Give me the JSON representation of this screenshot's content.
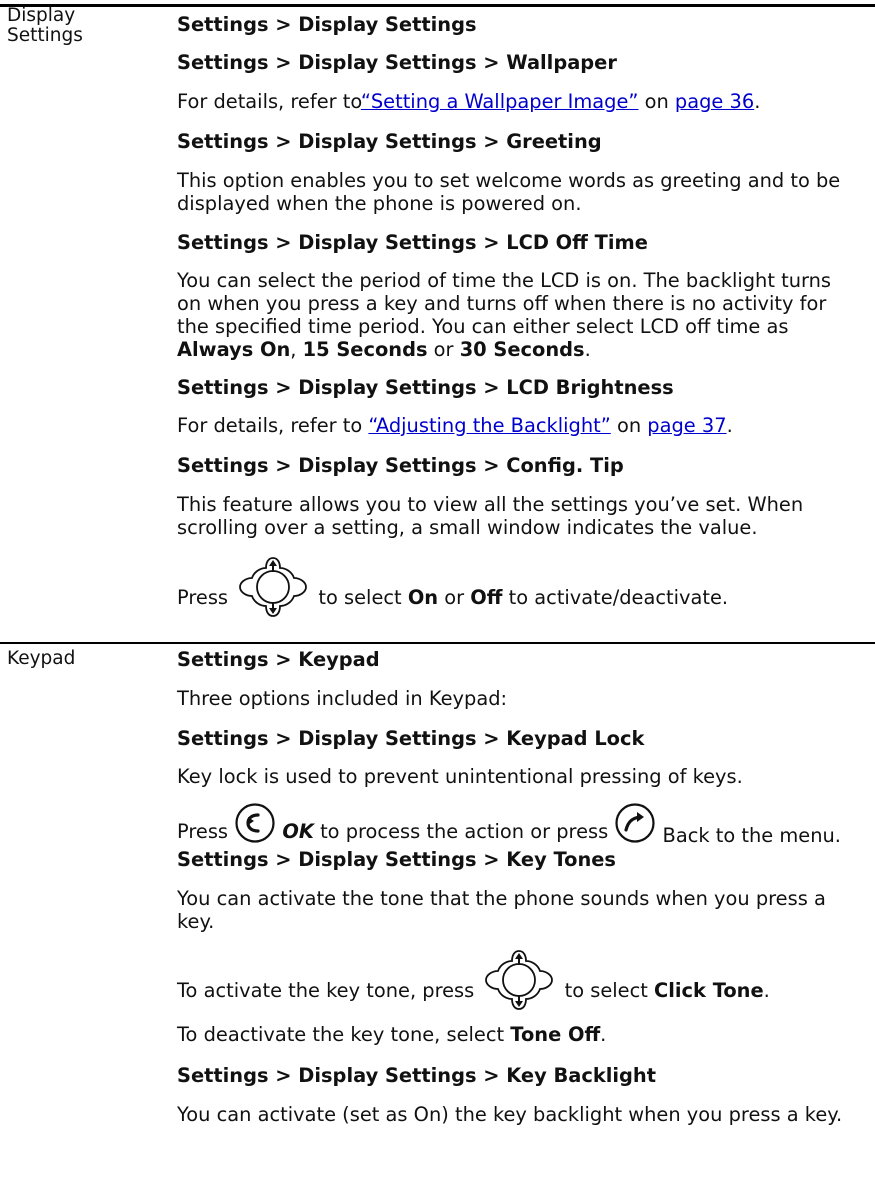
{
  "display_section": {
    "label_line1": "Display",
    "label_line2": "Settings",
    "h_main": "Settings > Display Settings",
    "h_wallpaper": "Settings > Display Settings > Wallpaper",
    "wallpaper_pre": "For details, refer to",
    "wallpaper_link": "“Setting a Wallpaper Image”",
    "wallpaper_on": " on ",
    "wallpaper_page": "page 36",
    "wallpaper_end": ".",
    "h_greeting": "Settings > Display Settings > Greeting",
    "greeting_l1": "This option enables you to set welcome words as greeting and to be",
    "greeting_l2": "displayed when the phone is powered on.",
    "h_lcd_off": "Settings > Display Settings > LCD Off Time",
    "lcd_l1": "You can select the period of time the LCD is on. The backlight turns",
    "lcd_l2": "on when you press a key and turns off when there is no activity for",
    "lcd_l3": "the specified time period. You can either select LCD off time as",
    "lcd_opt1": "Always On",
    "lcd_sep1": ", ",
    "lcd_opt2": "15 Seconds",
    "lcd_or": " or ",
    "lcd_opt3": "30 Seconds",
    "lcd_end": ".",
    "h_brightness": "Settings > Display Settings > LCD Brightness",
    "bright_pre": "For details, refer to ",
    "bright_link": "“Adjusting the Backlight”",
    "bright_on": " on ",
    "bright_page": "page 37",
    "bright_end": ".",
    "h_config": "Settings > Display Settings > Config. Tip",
    "config_l1": "This feature allows you to view all the settings you’ve set. When",
    "config_l2": "scrolling over a setting, a small window indicates the value.",
    "press": "Press",
    "press_mid": " to select ",
    "press_on": "On",
    "press_or": " or ",
    "press_off": "Off",
    "press_end": " to activate/deactivate."
  },
  "keypad_section": {
    "label": "Keypad",
    "h_main": "Settings > Keypad",
    "intro": "Three options included in Keypad:",
    "h_lock": "Settings > Display Settings > Keypad Lock",
    "lock_text": "Key lock is used to prevent unintentional pressing of keys.",
    "press": "Press",
    "ok": "OK",
    "ok_rest": " to process the action or press ",
    "back_rest": "Back to the menu.",
    "h_tones": "Settings > Display Settings > Key Tones",
    "tones_l1": "You can activate the tone that the phone sounds when you press a",
    "tones_l2": "key.",
    "activate_pre": "To activate the key tone, press",
    "activate_mid": " to select ",
    "click_tone": "Click Tone",
    "activate_end": ".",
    "deactivate_pre": "To deactivate the key tone, select ",
    "tone_off": "Tone Off",
    "deactivate_end": ".",
    "h_backlight": "Settings > Display Settings > Key Backlight",
    "backlight_text": "You can activate (set as On) the key backlight when you press a key."
  },
  "icons": [
    "nav-key-icon",
    "call-key-icon",
    "end-key-icon"
  ],
  "colors": {
    "link": "#0000cc",
    "text": "#111111",
    "rule": "#000000"
  }
}
